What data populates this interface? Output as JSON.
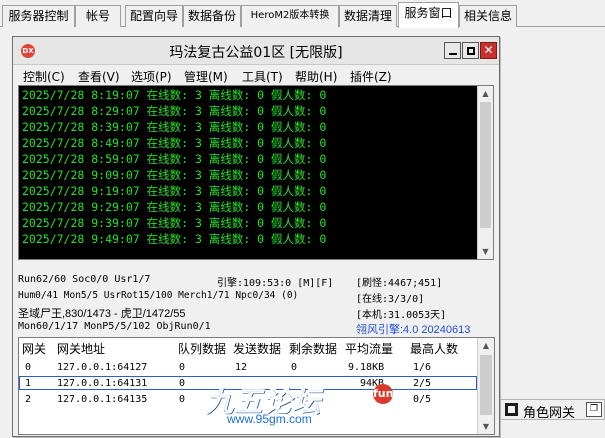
{
  "outer_tabs": [
    "服务器控制",
    "帐号",
    "配置向导",
    "数据备份",
    "HeroM2版本转换",
    "数据清理",
    "服务窗口",
    "相关信息"
  ],
  "active_tab_index": 6,
  "window": {
    "title": "玛法复古公益01区 [无限版]",
    "menus": [
      "控制(C)",
      "查看(V)",
      "选项(P)",
      "管理(M)",
      "工具(T)",
      "帮助(H)",
      "插件(Z)"
    ]
  },
  "console": {
    "text_color": "#23e323",
    "lines": [
      "2025/7/28 8:19:07 在线数: 3 离线数: 0 假人数: 0",
      "2025/7/28 8:29:07 在线数: 3 离线数: 0 假人数: 0",
      "2025/7/28 8:39:07 在线数: 3 离线数: 0 假人数: 0",
      "2025/7/28 8:49:07 在线数: 3 离线数: 0 假人数: 0",
      "2025/7/28 8:59:07 在线数: 3 离线数: 0 假人数: 0",
      "2025/7/28 9:09:07 在线数: 3 离线数: 0 假人数: 0",
      "2025/7/28 9:19:07 在线数: 3 离线数: 0 假人数: 0",
      "2025/7/28 9:29:07 在线数: 3 离线数: 0 假人数: 0",
      "2025/7/28 9:39:07 在线数: 3 离线数: 0 假人数: 0",
      "2025/7/28 9:49:07 在线数: 3 离线数: 0 假人数: 0"
    ]
  },
  "stats": {
    "line1": "Run62/60 Soc0/0 Usr1/7",
    "engine": "引擎:109:53:0 [M][F]",
    "refresh": "[刷怪:4467;451]",
    "line2": "Hum0/41 Mon5/5 UsrRot15/100 Merch1/71 Npc0/34 (0)",
    "online": "[在线:3/3/0]",
    "line3": "圣域尸王,830/1473 - 虎卫/1472/55",
    "local": "[本机:31.0053天]",
    "line4": "Mon60/1/17 MonP5/5/102 ObjRun0/1",
    "version": "翎风引擎:4.0 20240613"
  },
  "gateway_table": {
    "columns": [
      "网关",
      "网关地址",
      "队列数据",
      "发送数据",
      "剩余数据",
      "平均流量",
      "最高人数"
    ],
    "rows": [
      [
        "0",
        "127.0.0.1:64127",
        "0",
        "12",
        "0",
        "9.18KB",
        "1/6"
      ],
      [
        "1",
        "127.0.0.1:64131",
        "0",
        "",
        "",
        "94KB",
        "2/5"
      ],
      [
        "2",
        "127.0.0.1:64135",
        "0",
        "",
        "",
        "",
        "0/5"
      ]
    ],
    "selected_row": 1
  },
  "watermark": {
    "logo": "九五论坛",
    "url": "www.95gm.com",
    "badge": "fun"
  },
  "dock": {
    "label": "角色网关",
    "button_icon": "restore-icon"
  }
}
